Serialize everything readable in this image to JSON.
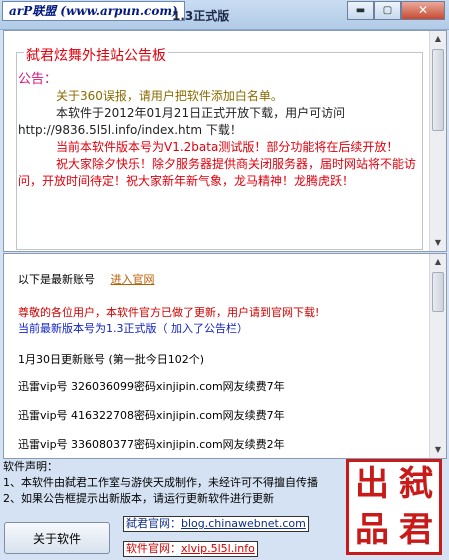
{
  "window": {
    "brand": "arP联盟 (www.arpun.com)",
    "title": "1.3正式版",
    "minimize": "▬",
    "maximize": "▢",
    "close": "✕"
  },
  "notice": {
    "group_title": "弑君炫舞外挂站公告板",
    "heading": "公告：",
    "lines": [
      "关于360误报，请用户把软件添加白名单。",
      "本软件于2012年01月21日正式开放下载，用户可访问",
      "http://9836.5l5l.info/index.htm  下载！",
      "当前本软件版本号为V1.2bata测试版！部分功能将在后续开放！",
      "祝大家除夕快乐！除夕服务器提供商关闭服务器，届时网站将不能访问，开放时间待定！祝大家新年新气象，龙马精神！龙腾虎跃！"
    ]
  },
  "info": {
    "latest_label": "以下是最新账号",
    "official_link": "进入官网",
    "update_notice": "尊敬的各位用户，本软件官方已做了更新，用户请到官网下载!",
    "version_line": "当前最新版本号为1.3正式版（ 加入了公告栏）",
    "date_line": "1月30日更新账号 (第一批今日102个)",
    "accounts": [
      "迅雷vip号  326036099密码xinjipin.com网友续费7年",
      "迅雷vip号  416322708密码xinjipin.com网友续费7年",
      "迅雷vip号  336080377密码xinjipin.com网友续费2年"
    ]
  },
  "declaration": {
    "title": "软件声明：",
    "items": [
      "1、本软件由弑君工作室与游侠天成制作，未经许可不得擅自传播",
      "2、如果公告框提示出新版本，请运行更新软件进行更新"
    ]
  },
  "enter_button": "关于软件",
  "links": {
    "blog_label": "弑君官网：",
    "blog_url": "blog.chinawebnet.com",
    "site_label": "软件官网：",
    "site_url": "xlvip.5l5l.info"
  },
  "seal": [
    "弑",
    "君",
    "出",
    "品"
  ],
  "colors": {
    "notice_title": "#e0000d",
    "pink": "#d7137a",
    "olive": "#8a6b00",
    "link_orange": "#b75d00",
    "blue": "#1022c8",
    "seal_red": "#c91a1a"
  }
}
